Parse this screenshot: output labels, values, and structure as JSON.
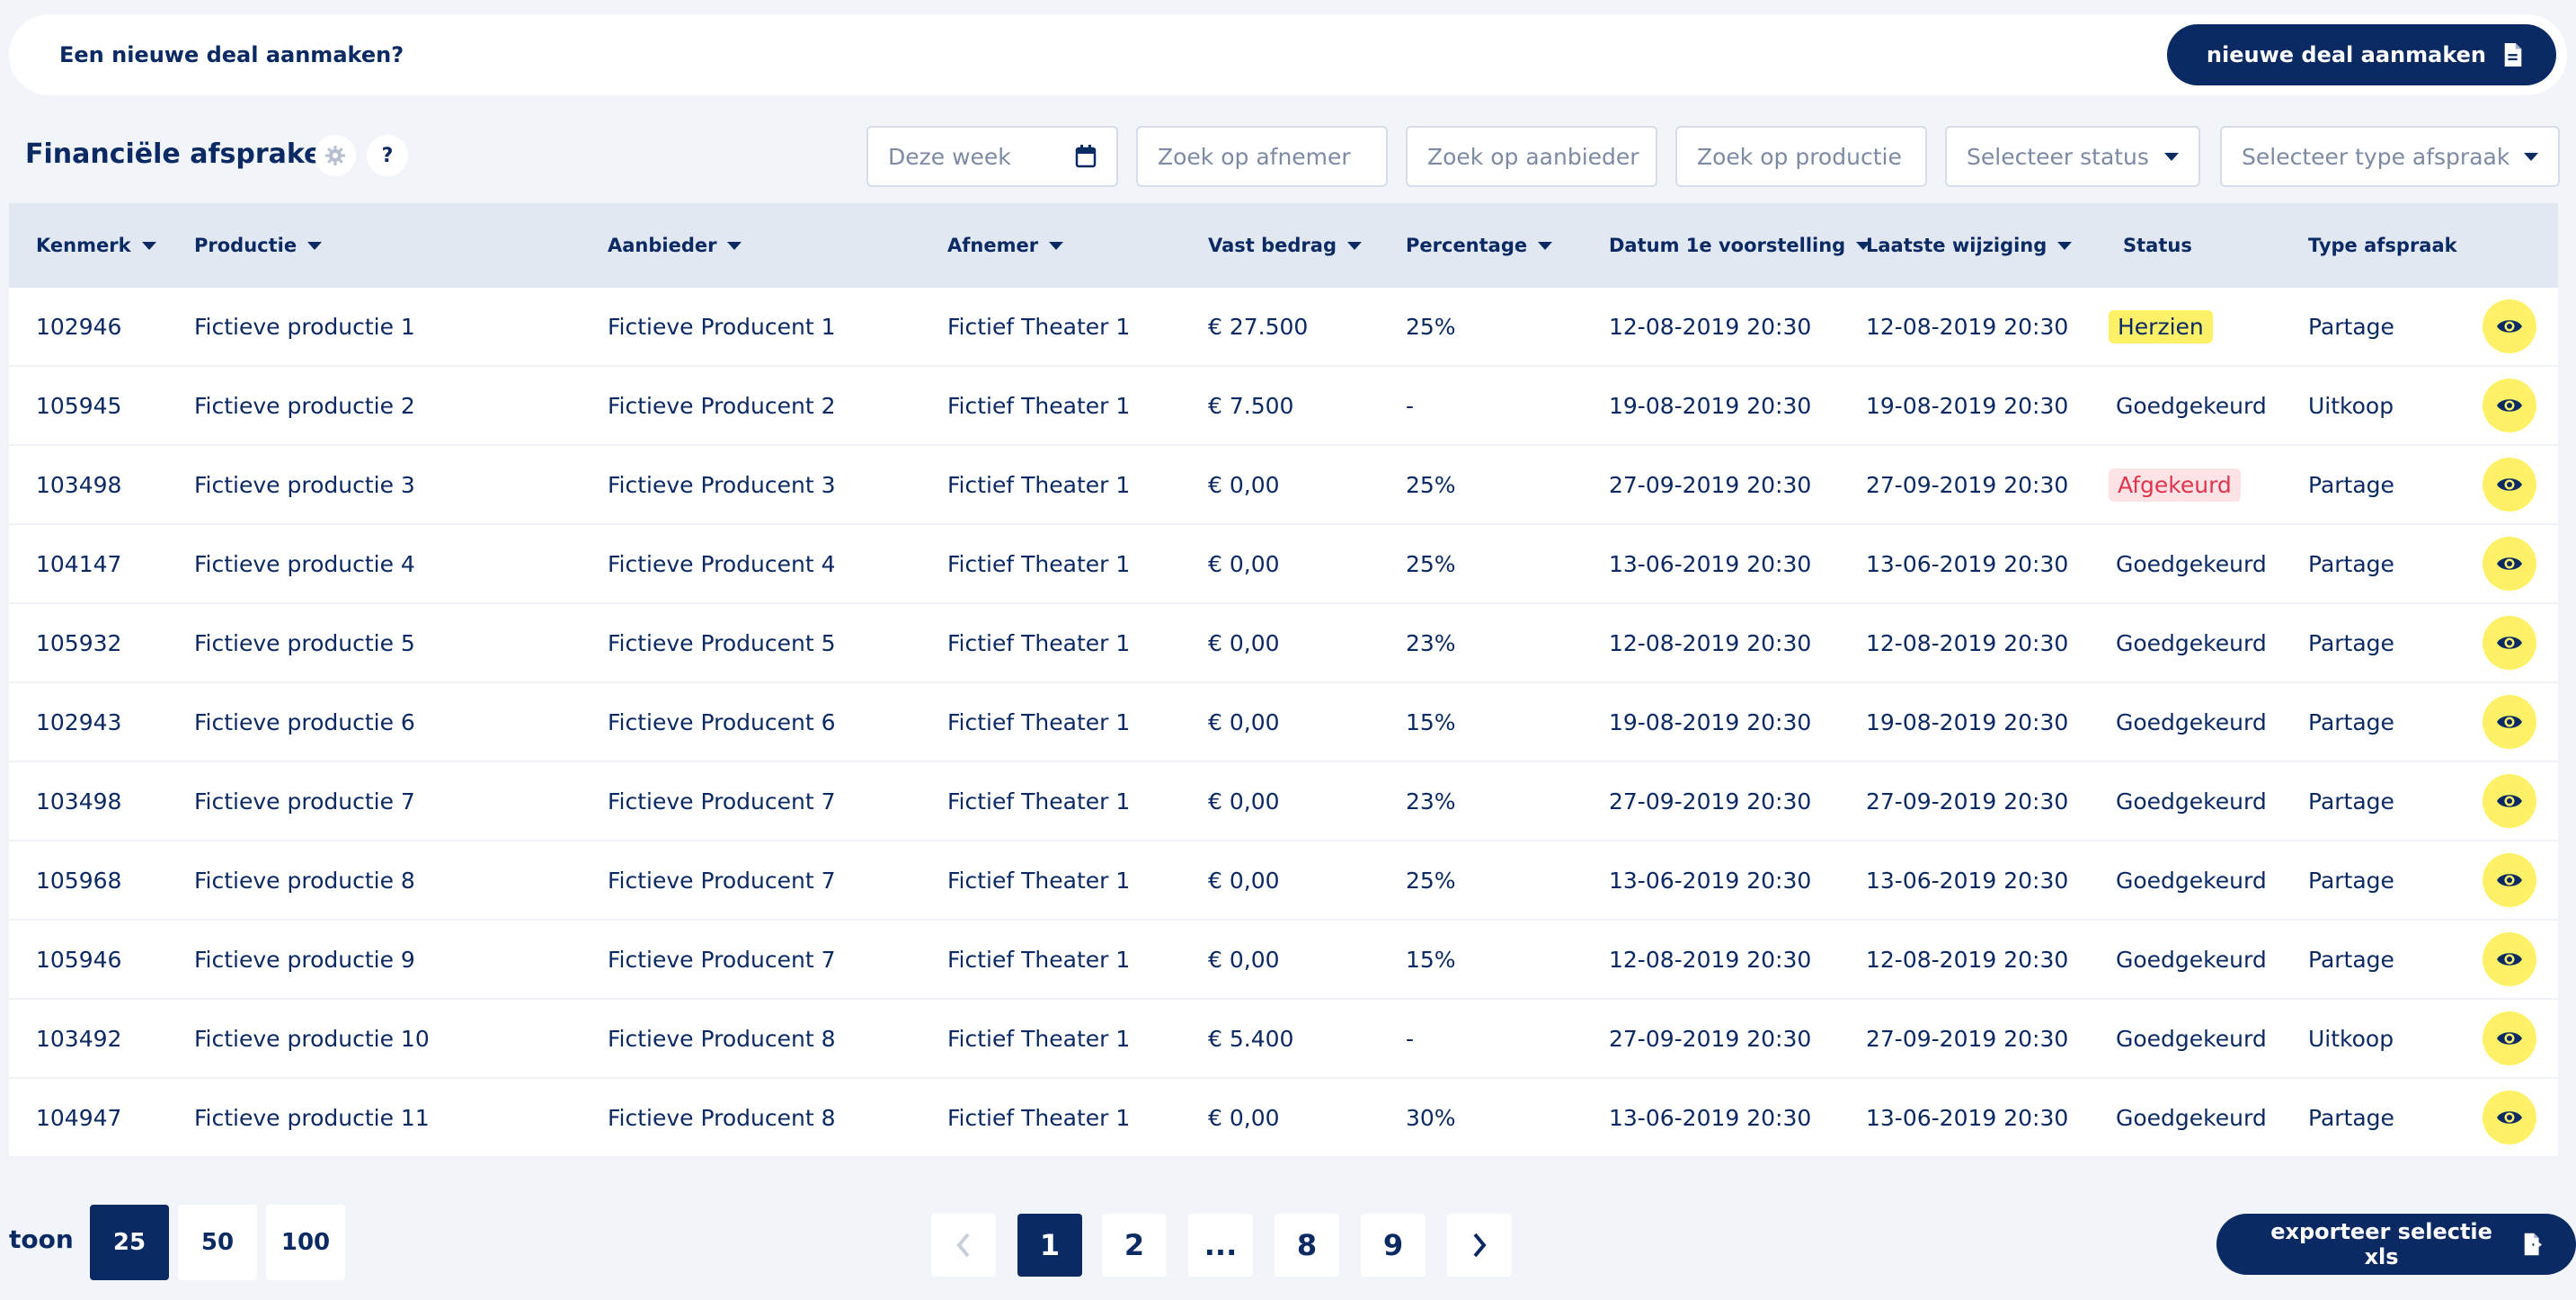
{
  "banner": {
    "text": "Een nieuwe deal aanmaken?",
    "button_label": "nieuwe deal aanmaken",
    "button_icon": "document-icon"
  },
  "toolbar": {
    "title": "Financiële afspraken",
    "settings_icon": "gear-icon",
    "help_label": "?",
    "filters": {
      "week": "Deze week",
      "afnemer": "Zoek op afnemer",
      "aanbieder": "Zoek op aanbieder",
      "productie": "Zoek op productie",
      "status": "Selecteer status",
      "type": "Selecteer type afspraak"
    }
  },
  "table": {
    "columns": {
      "kenmerk": "Kenmerk",
      "productie": "Productie",
      "aanbieder": "Aanbieder",
      "afnemer": "Afnemer",
      "vast_bedrag": "Vast bedrag",
      "percentage": "Percentage",
      "datum": "Datum 1e voorstelling",
      "wijziging": "Laatste wijziging",
      "status": "Status",
      "type": "Type afspraak"
    },
    "rows": [
      {
        "kenmerk": "102946",
        "productie": "Fictieve productie 1",
        "aanbieder": "Fictieve Producent 1",
        "afnemer": "Fictief Theater 1",
        "bedrag": "€ 27.500",
        "percentage": "25%",
        "datum": "12-08-2019 20:30",
        "wijziging": "12-08-2019 20:30",
        "status": "Herzien",
        "type": "Partage"
      },
      {
        "kenmerk": "105945",
        "productie": "Fictieve productie 2",
        "aanbieder": "Fictieve Producent 2",
        "afnemer": "Fictief Theater 1",
        "bedrag": "€ 7.500",
        "percentage": "-",
        "datum": "19-08-2019 20:30",
        "wijziging": "19-08-2019 20:30",
        "status": "Goedgekeurd",
        "type": "Uitkoop"
      },
      {
        "kenmerk": "103498",
        "productie": "Fictieve productie 3",
        "aanbieder": "Fictieve Producent 3",
        "afnemer": "Fictief Theater 1",
        "bedrag": "€ 0,00",
        "percentage": "25%",
        "datum": "27-09-2019 20:30",
        "wijziging": "27-09-2019 20:30",
        "status": "Afgekeurd",
        "type": "Partage"
      },
      {
        "kenmerk": "104147",
        "productie": "Fictieve productie 4",
        "aanbieder": "Fictieve Producent 4",
        "afnemer": "Fictief Theater 1",
        "bedrag": "€ 0,00",
        "percentage": "25%",
        "datum": "13-06-2019 20:30",
        "wijziging": "13-06-2019 20:30",
        "status": "Goedgekeurd",
        "type": "Partage"
      },
      {
        "kenmerk": "105932",
        "productie": "Fictieve productie 5",
        "aanbieder": "Fictieve Producent 5",
        "afnemer": "Fictief Theater 1",
        "bedrag": "€ 0,00",
        "percentage": "23%",
        "datum": "12-08-2019 20:30",
        "wijziging": "12-08-2019 20:30",
        "status": "Goedgekeurd",
        "type": "Partage"
      },
      {
        "kenmerk": "102943",
        "productie": "Fictieve productie 6",
        "aanbieder": "Fictieve Producent 6",
        "afnemer": "Fictief Theater 1",
        "bedrag": "€ 0,00",
        "percentage": "15%",
        "datum": "19-08-2019 20:30",
        "wijziging": "19-08-2019 20:30",
        "status": "Goedgekeurd",
        "type": "Partage"
      },
      {
        "kenmerk": "103498",
        "productie": "Fictieve productie 7",
        "aanbieder": "Fictieve Producent 7",
        "afnemer": "Fictief Theater 1",
        "bedrag": "€ 0,00",
        "percentage": "23%",
        "datum": "27-09-2019 20:30",
        "wijziging": "27-09-2019 20:30",
        "status": "Goedgekeurd",
        "type": "Partage"
      },
      {
        "kenmerk": "105968",
        "productie": "Fictieve productie 8",
        "aanbieder": "Fictieve Producent 7",
        "afnemer": "Fictief Theater 1",
        "bedrag": "€ 0,00",
        "percentage": "25%",
        "datum": "13-06-2019 20:30",
        "wijziging": "13-06-2019 20:30",
        "status": "Goedgekeurd",
        "type": "Partage"
      },
      {
        "kenmerk": "105946",
        "productie": "Fictieve productie 9",
        "aanbieder": "Fictieve Producent 7",
        "afnemer": "Fictief Theater 1",
        "bedrag": "€ 0,00",
        "percentage": "15%",
        "datum": "12-08-2019 20:30",
        "wijziging": "12-08-2019 20:30",
        "status": "Goedgekeurd",
        "type": "Partage"
      },
      {
        "kenmerk": "103492",
        "productie": "Fictieve productie 10",
        "aanbieder": "Fictieve Producent 8",
        "afnemer": "Fictief Theater 1",
        "bedrag": "€ 5.400",
        "percentage": "-",
        "datum": "27-09-2019 20:30",
        "wijziging": "27-09-2019 20:30",
        "status": "Goedgekeurd",
        "type": "Uitkoop"
      },
      {
        "kenmerk": "104947",
        "productie": "Fictieve productie 11",
        "aanbieder": "Fictieve Producent 8",
        "afnemer": "Fictief Theater 1",
        "bedrag": "€ 0,00",
        "percentage": "30%",
        "datum": "13-06-2019 20:30",
        "wijziging": "13-06-2019 20:30",
        "status": "Goedgekeurd",
        "type": "Partage"
      }
    ]
  },
  "footer": {
    "toon_label": "toon",
    "page_sizes": [
      "25",
      "50",
      "100"
    ],
    "pages": [
      "1",
      "2",
      "...",
      "8",
      "9"
    ],
    "export_label": "exporteer selectie xls",
    "export_icon": "file-export-icon"
  },
  "colors": {
    "navy": "#0b2a63",
    "yellow": "#fef167",
    "red": "#e0344d",
    "background": "#f1f4f9"
  }
}
